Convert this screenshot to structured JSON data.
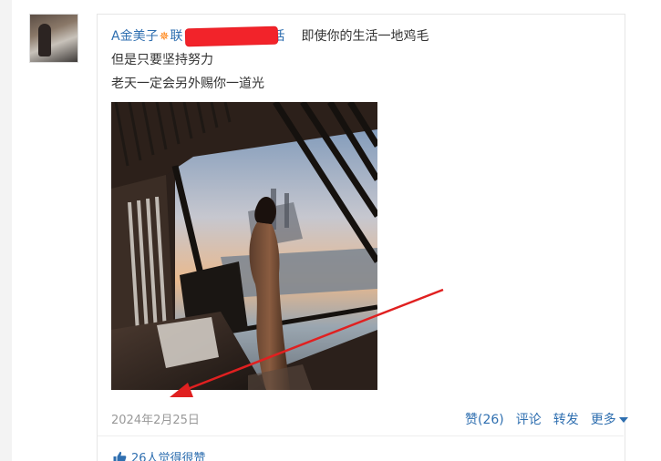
{
  "post": {
    "author": "A金美子",
    "spark_icon": "✵",
    "author_tag_prefix": "联",
    "author_tag_suffix": "话",
    "lines": [
      "即使你的生活一地鸡毛",
      "但是只要坚持努力",
      "老天一定会另外赐你一道光"
    ],
    "date": "2024年2月25日"
  },
  "actions": {
    "like": "赞(26)",
    "comment": "评论",
    "share": "转发",
    "more": "更多"
  },
  "likes_summary": "26人觉得很赞",
  "icons": {
    "avatar": "avatar-photo",
    "thumb": "thumbs-up-icon",
    "caret": "chevron-down-icon",
    "annotation": "red-arrow-annotation"
  },
  "colors": {
    "link": "#2f6fb0",
    "text": "#333333",
    "muted": "#999999",
    "redaction": "#f2232a",
    "annotation": "#e02020"
  }
}
